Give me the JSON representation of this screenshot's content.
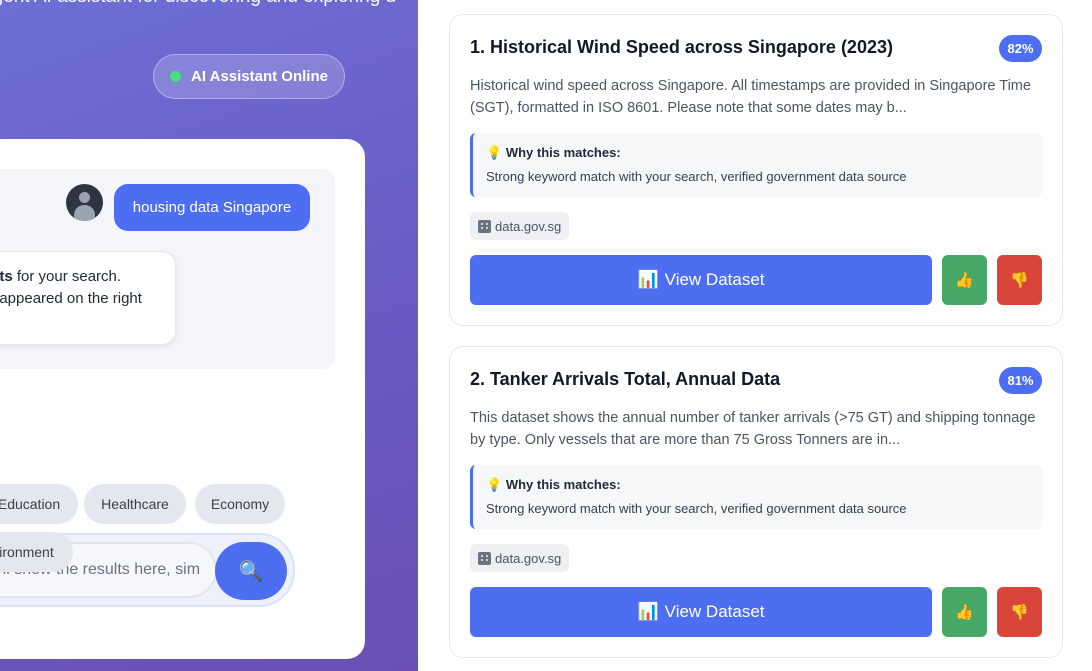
{
  "header": {
    "tagline": "lligent AI assistant for discovering and exploring d",
    "status": "AI Assistant Online"
  },
  "chat": {
    "user_message": "housing data Singapore",
    "bot_line1_bold": "ets",
    "bot_line1_rest": " for your search.",
    "bot_line2": "t appeared on the right"
  },
  "search": {
    "placeholder": "and I'll show the results here, sim",
    "button_icon": "search-icon"
  },
  "chips": [
    "Education",
    "Healthcare",
    "Economy",
    "ironment"
  ],
  "results": [
    {
      "title": "1. Historical Wind Speed across Singapore (2023)",
      "score": "82%",
      "description": "Historical wind speed across Singapore. All timestamps are provided in Singapore Time (SGT), formatted in ISO 8601. Please note that some dates may b...",
      "why_title": "Why this matches:",
      "why_text": "Strong keyword match with your search, verified government data source",
      "source": "data.gov.sg",
      "view_label": "View Dataset"
    },
    {
      "title": "2. Tanker Arrivals Total, Annual Data",
      "score": "81%",
      "description": "This dataset shows the annual number of tanker arrivals (>75 GT) and shipping tonnage by type. Only vessels that are more than 75 Gross Tonners are in...",
      "why_title": "Why this matches:",
      "why_text": "Strong keyword match with your search, verified government data source",
      "source": "data.gov.sg",
      "view_label": "View Dataset"
    }
  ],
  "colors": {
    "accent": "#4e6ef2",
    "thumbs_up": "#48a868",
    "thumbs_down": "#d9453a",
    "online_dot": "#4ade80"
  }
}
